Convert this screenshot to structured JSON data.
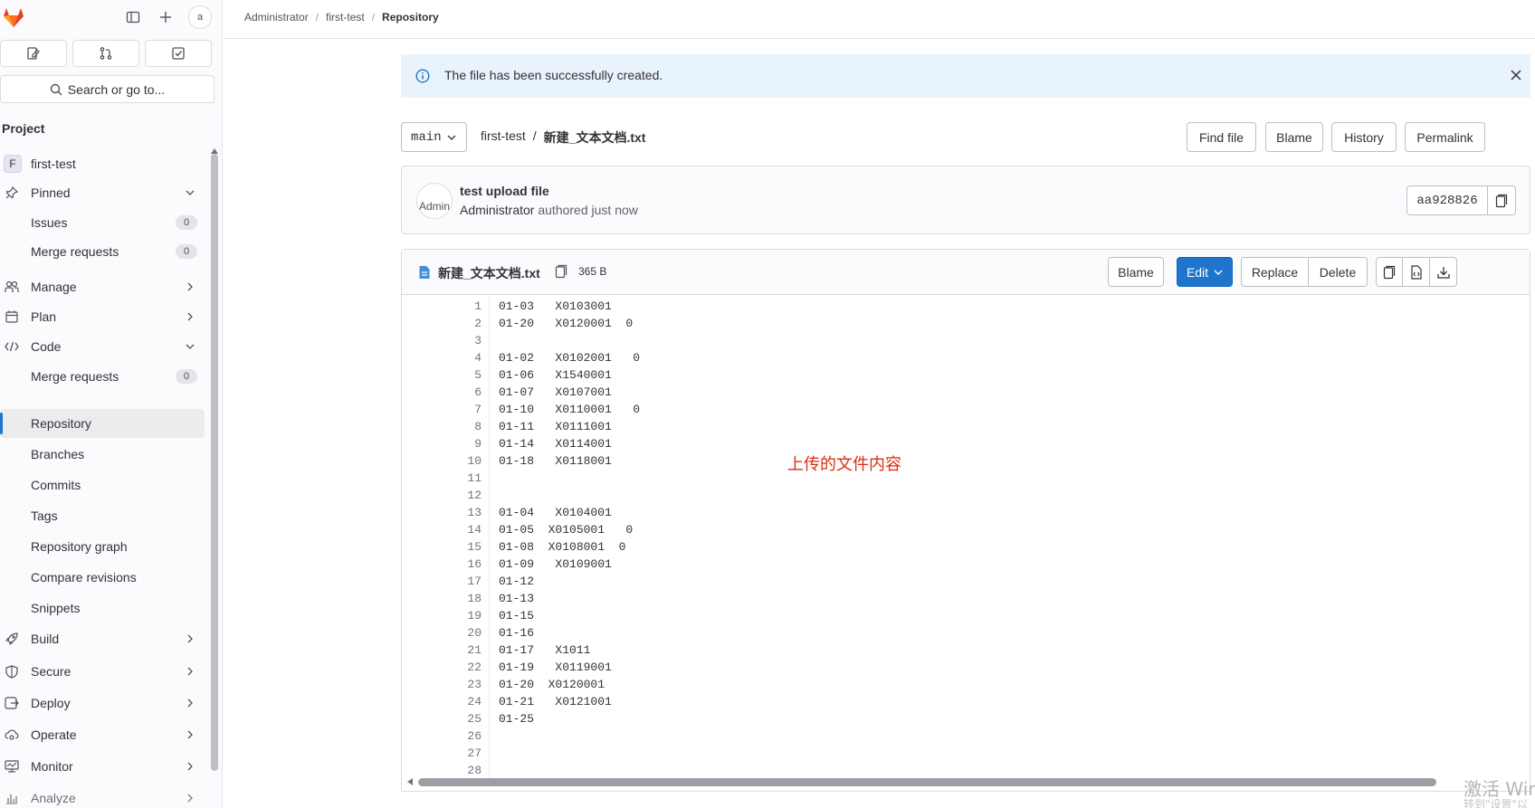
{
  "sidebar": {
    "avatar_alt": "a",
    "search_label": "Search or go to...",
    "heading": "Project",
    "project": {
      "initial": "F",
      "name": "first-test"
    },
    "items": [
      {
        "label": "Pinned",
        "icon": "pin-icon",
        "chevron": "down"
      },
      {
        "label": "Issues",
        "badge": "0",
        "sub": true
      },
      {
        "label": "Merge requests",
        "badge": "0",
        "sub": true
      },
      {
        "label": "Manage",
        "icon": "users-icon",
        "chevron": "right"
      },
      {
        "label": "Plan",
        "icon": "calendar-icon",
        "chevron": "right"
      },
      {
        "label": "Code",
        "icon": "code-icon",
        "chevron": "down"
      },
      {
        "label": "Merge requests",
        "badge": "0",
        "sub": true
      },
      {
        "label": "Repository",
        "sub": true,
        "active": true
      },
      {
        "label": "Branches",
        "sub": true
      },
      {
        "label": "Commits",
        "sub": true
      },
      {
        "label": "Tags",
        "sub": true
      },
      {
        "label": "Repository graph",
        "sub": true
      },
      {
        "label": "Compare revisions",
        "sub": true
      },
      {
        "label": "Snippets",
        "sub": true
      },
      {
        "label": "Build",
        "icon": "rocket-icon",
        "chevron": "right"
      },
      {
        "label": "Secure",
        "icon": "shield-icon",
        "chevron": "right"
      },
      {
        "label": "Deploy",
        "icon": "deploy-icon",
        "chevron": "right"
      },
      {
        "label": "Operate",
        "icon": "cloud-gear-icon",
        "chevron": "right"
      },
      {
        "label": "Monitor",
        "icon": "monitor-icon",
        "chevron": "right"
      },
      {
        "label": "Analyze",
        "icon": "chart-icon",
        "chevron": "right"
      }
    ]
  },
  "breadcrumb": [
    "Administrator",
    "first-test",
    "Repository"
  ],
  "alert": {
    "text": "The file has been successfully created."
  },
  "file_header": {
    "branch": "main",
    "path_root": "first-test",
    "path_sep": "/",
    "file_name": "新建_文本文档.txt",
    "buttons": [
      "Find file",
      "Blame",
      "History",
      "Permalink"
    ]
  },
  "commit": {
    "avatar_alt": "Admin",
    "title": "test upload file",
    "author": "Administrator",
    "meta": "authored just now",
    "sha": "aa928826"
  },
  "blob": {
    "file_name": "新建_文本文档.txt",
    "size": "365 B",
    "buttons": {
      "blame": "Blame",
      "edit": "Edit",
      "replace": "Replace",
      "delete": "Delete"
    },
    "lines": [
      "01-03   X0103001",
      "01-20   X0120001  0",
      "",
      "01-02   X0102001   0",
      "01-06   X1540001",
      "01-07   X0107001",
      "01-10   X0110001   0",
      "01-11   X0111001",
      "01-14   X0114001",
      "01-18   X0118001",
      "",
      "",
      "01-04   X0104001",
      "01-05  X0105001   0",
      "01-08  X0108001  0",
      "01-09   X0109001",
      "01-12",
      "01-13",
      "01-15",
      "01-16",
      "01-17   X1011",
      "01-19   X0119001",
      "01-20  X0120001",
      "01-21   X0121001",
      "01-25",
      "",
      "",
      ""
    ],
    "annotation": "上传的文件内容"
  },
  "watermark": {
    "line1": "激活 Wir",
    "line2": "转到\"设置\"以"
  },
  "colors": {
    "accent": "#1f75cb",
    "alert_bg": "#e9f3fc",
    "annotation": "#dd2b0e"
  }
}
